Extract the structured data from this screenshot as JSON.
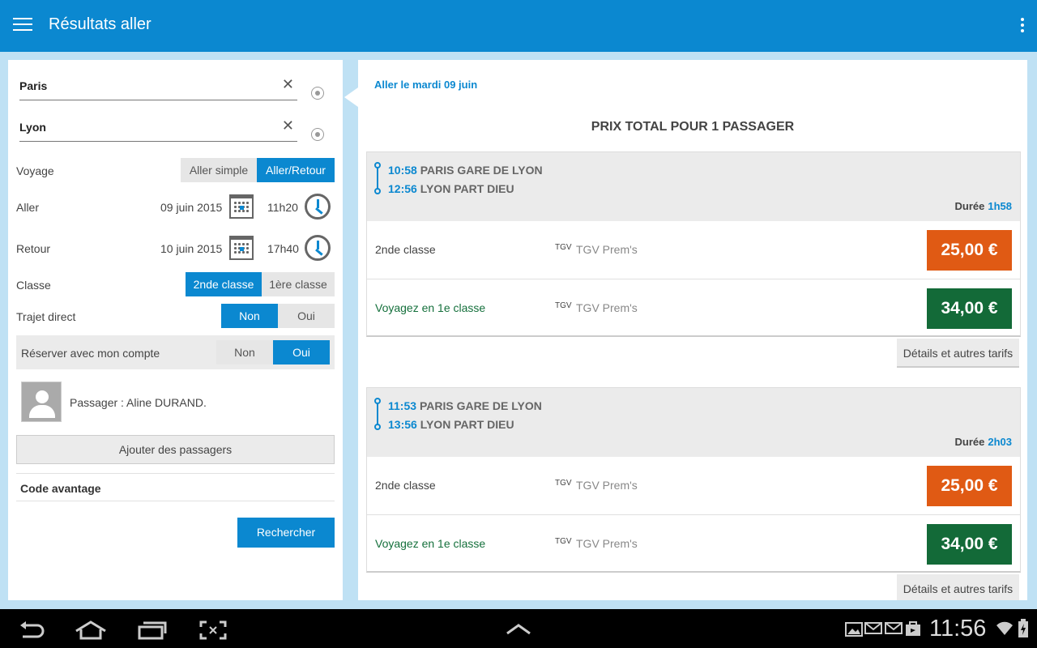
{
  "appbar": {
    "title": "Résultats aller"
  },
  "form": {
    "from": "Paris",
    "to": "Lyon",
    "voyage_label": "Voyage",
    "voyage_options": [
      "Aller simple",
      "Aller/Retour"
    ],
    "aller_label": "Aller",
    "aller_date": "09 juin 2015",
    "aller_time": "11h20",
    "retour_label": "Retour",
    "retour_date": "10 juin 2015",
    "retour_time": "17h40",
    "classe_label": "Classe",
    "classe_options": [
      "2nde classe",
      "1ère classe"
    ],
    "direct_label": "Trajet direct",
    "direct_options": [
      "Non",
      "Oui"
    ],
    "compte_label": "Réserver avec mon compte",
    "compte_options": [
      "Non",
      "Oui"
    ],
    "passager": "Passager : Aline  DURAND.",
    "add_passengers": "Ajouter des passagers",
    "code_avantage": "Code avantage",
    "search_button": "Rechercher"
  },
  "results": {
    "date_header": "Aller le mardi 09 juin",
    "price_header": "PRIX TOTAL POUR 1 PASSAGER",
    "duree_label": "Durée",
    "details_label": "Détails et autres tarifs",
    "trips": [
      {
        "dep_time": "10:58",
        "dep_station": "PARIS GARE DE LYON",
        "arr_time": "12:56",
        "arr_station": "LYON PART DIEU",
        "duration": "1h58",
        "fares": [
          {
            "class": "2nde classe",
            "tgv": "TGV",
            "name": "TGV Prem's",
            "price": "25,00 €",
            "color": "#e05a14"
          },
          {
            "class": "Voyagez en 1e classe",
            "tgv": "TGV",
            "name": "TGV Prem's",
            "price": "34,00 €",
            "color": "#136a38"
          }
        ]
      },
      {
        "dep_time": "11:53",
        "dep_station": "PARIS GARE DE LYON",
        "arr_time": "13:56",
        "arr_station": "LYON PART DIEU",
        "duration": "2h03",
        "fares": [
          {
            "class": "2nde classe",
            "tgv": "TGV",
            "name": "TGV Prem's",
            "price": "25,00 €",
            "color": "#e05a14"
          },
          {
            "class": "Voyagez en 1e classe",
            "tgv": "TGV",
            "name": "TGV Prem's",
            "price": "34,00 €",
            "color": "#136a38"
          }
        ]
      }
    ]
  },
  "system": {
    "time": "11:56"
  },
  "colors": {
    "primary": "#0b88d0",
    "orange": "#e05a14",
    "green": "#136a38"
  }
}
